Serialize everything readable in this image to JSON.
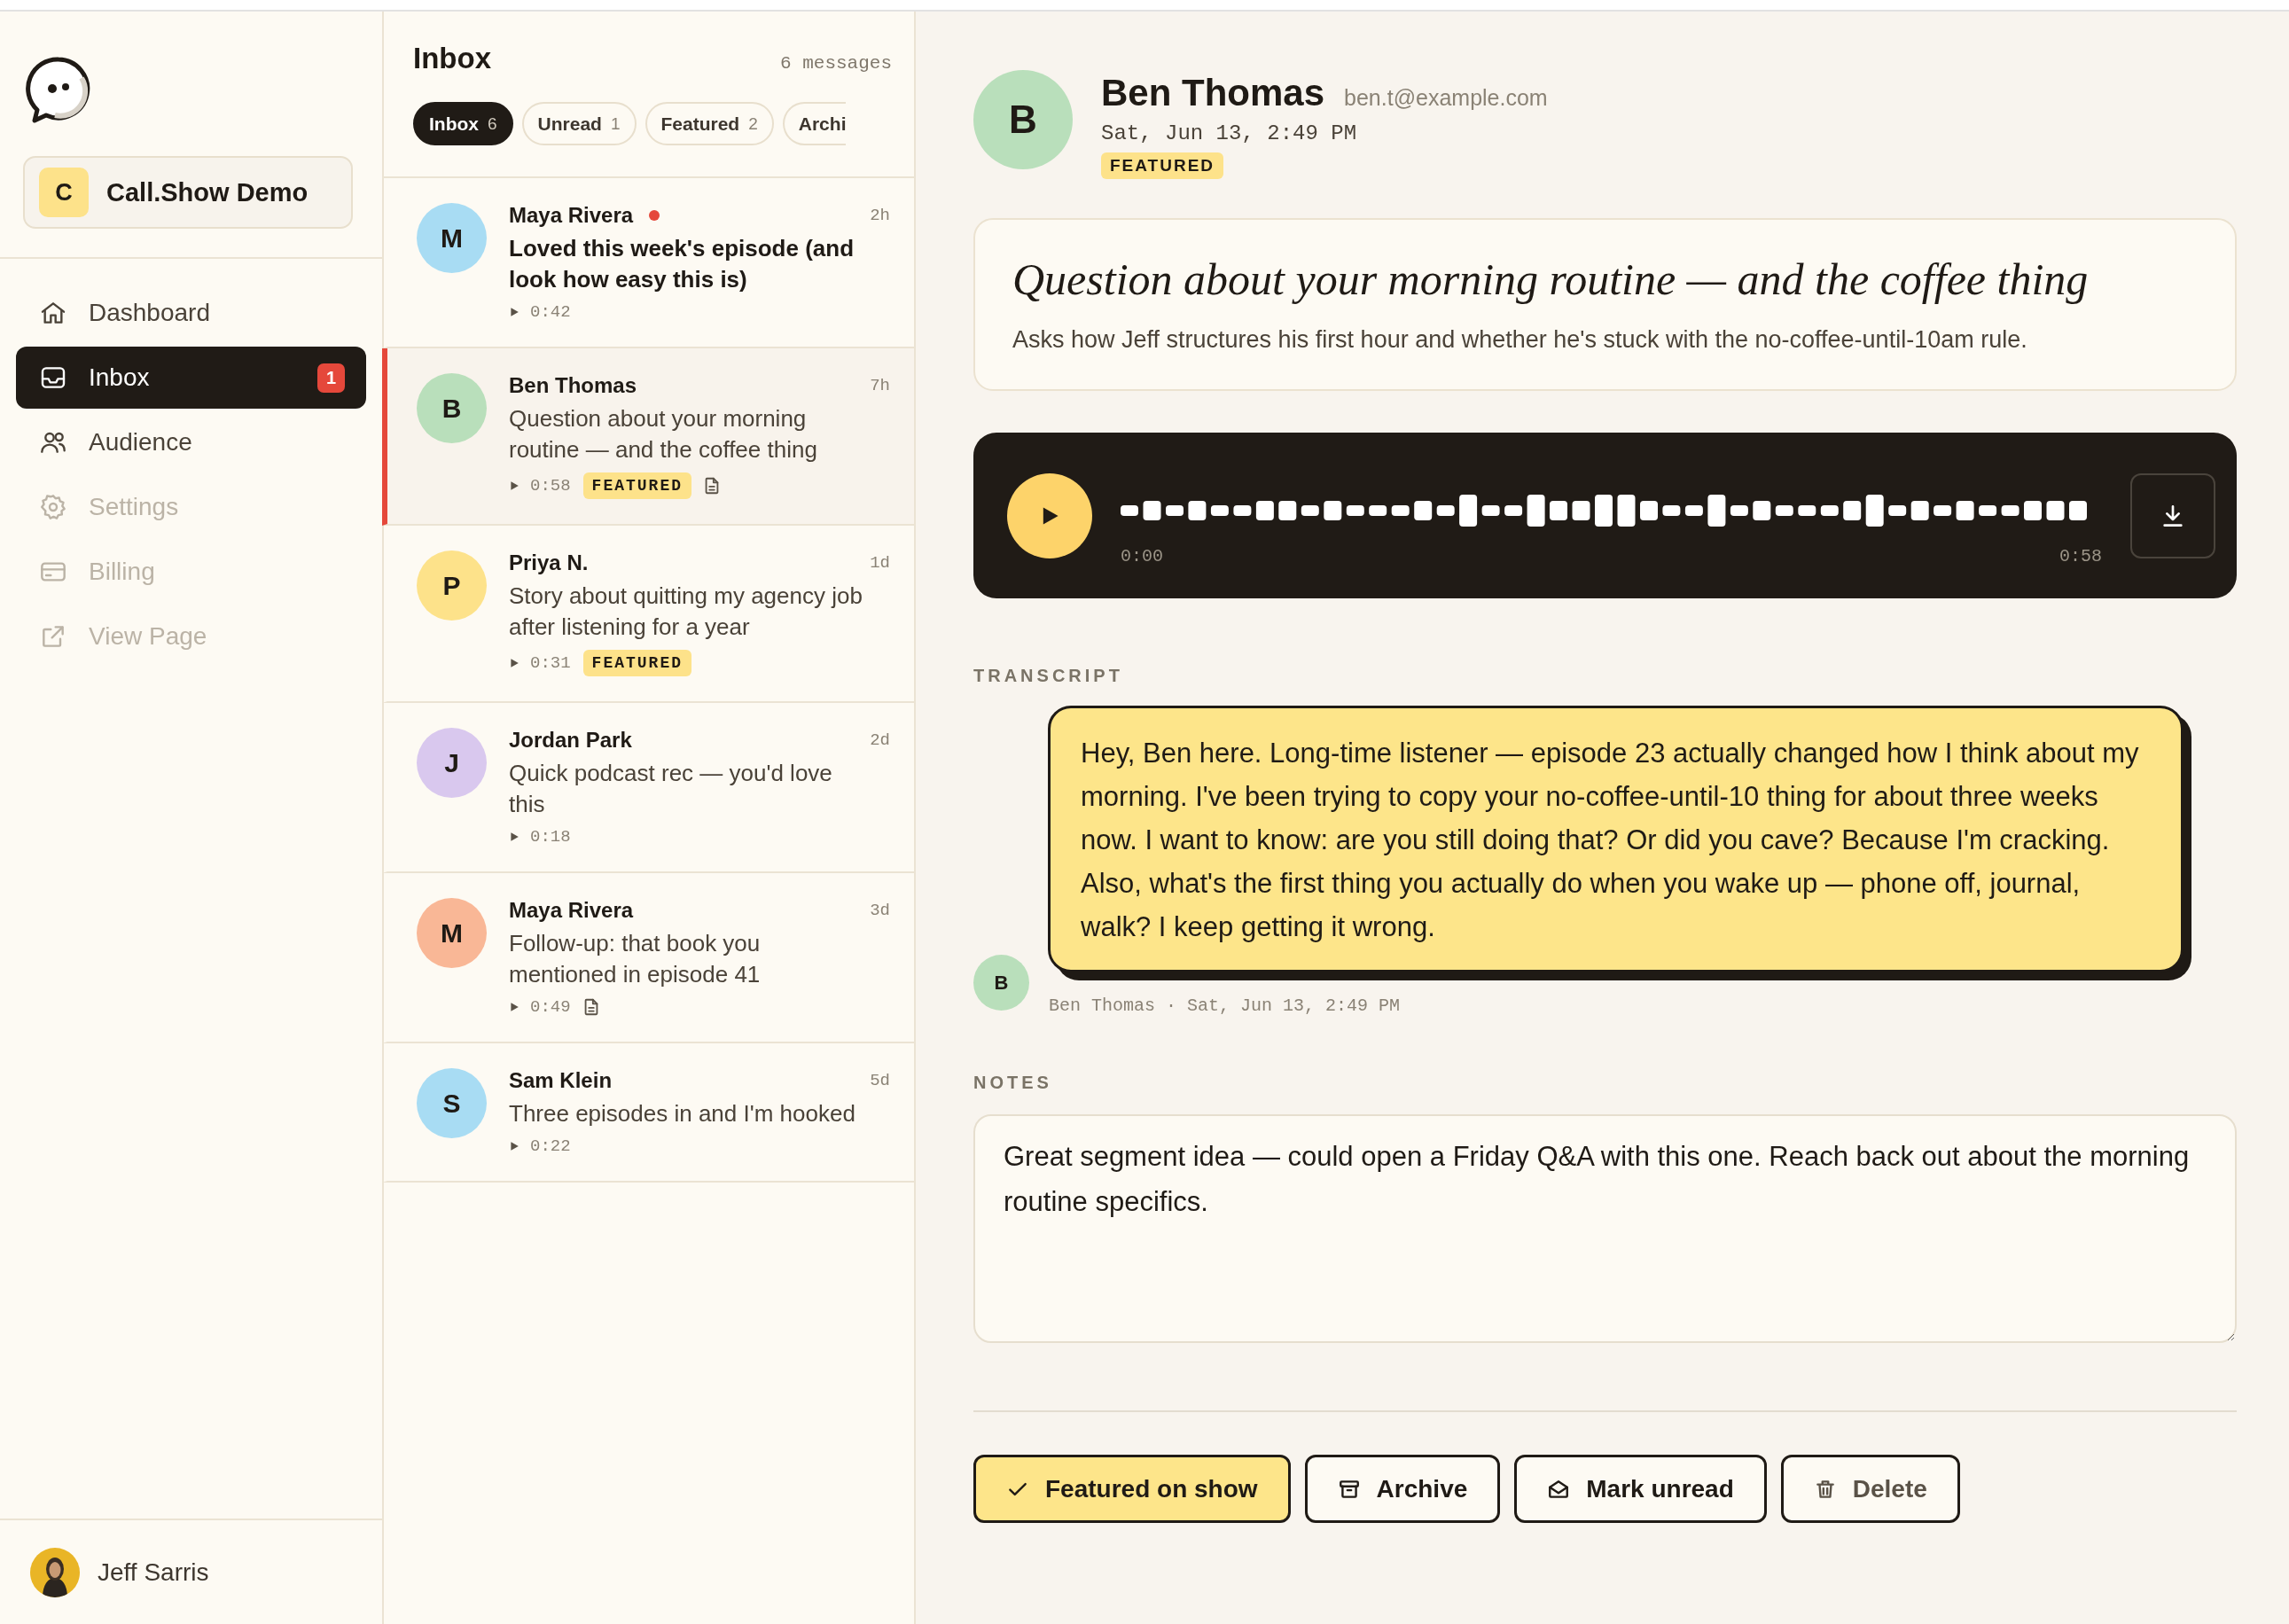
{
  "sidebar": {
    "workspace": {
      "initial": "C",
      "name": "Call.Show Demo"
    },
    "nav": [
      {
        "label": "Dashboard",
        "selected": false,
        "disabled": false
      },
      {
        "label": "Inbox",
        "selected": true,
        "disabled": false,
        "badge": "1"
      },
      {
        "label": "Audience",
        "selected": false,
        "disabled": false
      },
      {
        "label": "Settings",
        "selected": false,
        "disabled": true
      },
      {
        "label": "Billing",
        "selected": false,
        "disabled": true
      },
      {
        "label": "View Page",
        "selected": false,
        "disabled": true
      }
    ],
    "user": {
      "name": "Jeff Sarris"
    }
  },
  "inbox": {
    "title": "Inbox",
    "count": "6 messages",
    "tabs": [
      {
        "label": "Inbox",
        "count": "6",
        "selected": true
      },
      {
        "label": "Unread",
        "count": "1",
        "selected": false
      },
      {
        "label": "Featured",
        "count": "2",
        "selected": false
      },
      {
        "label": "Archi",
        "selected": false
      }
    ],
    "messages": [
      {
        "initial": "M",
        "color": "#a8dcf3",
        "name": "Maya Rivera",
        "time": "2h",
        "subject": "Loved this week's episode (and look how easy this is)",
        "duration": "0:42",
        "unread": true,
        "selected": false,
        "note": false
      },
      {
        "initial": "B",
        "color": "#b9dfbb",
        "name": "Ben Thomas",
        "time": "7h",
        "subject": "Question about your morning routine — and the coffee thing",
        "duration": "0:58",
        "badge": "FEATURED",
        "unread": false,
        "selected": true,
        "note": true
      },
      {
        "initial": "P",
        "color": "#fde28a",
        "name": "Priya N.",
        "time": "1d",
        "subject": "Story about quitting my agency job after listening for a year",
        "duration": "0:31",
        "badge": "FEATURED",
        "unread": false,
        "selected": false,
        "note": false
      },
      {
        "initial": "J",
        "color": "#d9c8ee",
        "name": "Jordan Park",
        "time": "2d",
        "subject": "Quick podcast rec — you'd love this",
        "duration": "0:18",
        "unread": false,
        "selected": false,
        "note": false
      },
      {
        "initial": "M",
        "color": "#f9b796",
        "name": "Maya Rivera",
        "time": "3d",
        "subject": "Follow-up: that book you mentioned in episode 41",
        "duration": "0:49",
        "unread": false,
        "selected": false,
        "note": true
      },
      {
        "initial": "S",
        "color": "#a8dcf3",
        "name": "Sam Klein",
        "time": "5d",
        "subject": "Three episodes in and I'm hooked",
        "duration": "0:22",
        "unread": false,
        "selected": false,
        "note": false
      }
    ]
  },
  "detail": {
    "avatar": {
      "initial": "B",
      "color": "#b9dfbb"
    },
    "name": "Ben Thomas",
    "email": "ben.t@example.com",
    "date": "Sat, Jun 13, 2:49 PM",
    "badge": "FEATURED",
    "title": "Question about your morning routine — and the coffee thing",
    "summary": "Asks how Jeff structures his first hour and whether he's stuck with the no-coffee-until-10am rule.",
    "player": {
      "start": "0:00",
      "end": "0:58"
    },
    "transcript": {
      "label": "TRANSCRIPT",
      "text": "Hey, Ben here. Long-time listener — episode 23 actually changed how I think about my morning. I've been trying to copy your no-coffee-until-10 thing for about three weeks now. I want to know: are you still doing that? Or did you cave? Because I'm cracking. Also, what's the first thing you actually do when you wake up — phone off, journal, walk? I keep getting it wrong.",
      "avatar": {
        "initial": "B",
        "color": "#b9dfbb"
      },
      "caption": "Ben Thomas · Sat, Jun 13, 2:49 PM"
    },
    "notes": {
      "label": "NOTES",
      "value": "Great segment idea — could open a Friday Q&A with this one. Reach back out about the morning routine specifics."
    },
    "actions": [
      {
        "kind": "feature",
        "label": "Featured on show",
        "on": true
      },
      {
        "kind": "archive",
        "label": "Archive",
        "on": false
      },
      {
        "kind": "unread",
        "label": "Mark unread",
        "on": false
      },
      {
        "kind": "delete",
        "label": "Delete",
        "on": false
      }
    ]
  }
}
